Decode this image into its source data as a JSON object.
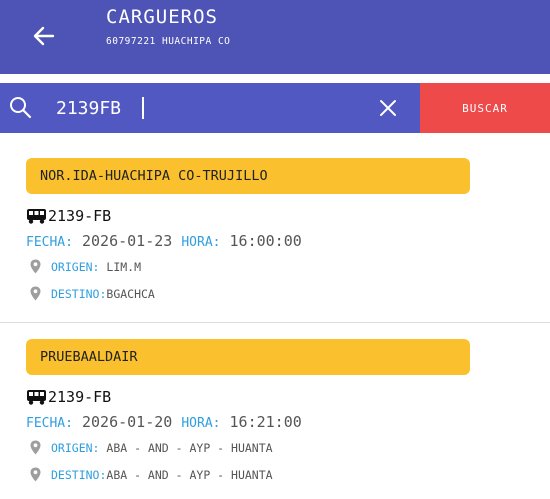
{
  "header": {
    "title": "CARGUEROS",
    "subtitle": "60797221 HUACHIPA CO"
  },
  "search": {
    "value": "2139FB",
    "button_label": "BUSCAR"
  },
  "colors": {
    "appbar": "#4e54b6",
    "searchbar": "#5158c2",
    "buscar": "#ef4a4a",
    "route_badge": "#fbc02d",
    "label_blue": "#2f9fe0"
  },
  "trips": [
    {
      "route": "NOR.IDA-HUACHIPA CO-TRUJILLO",
      "plate": "2139-FB",
      "fecha_label": "FECHA:",
      "fecha": "2026-01-23",
      "hora_label": "HORA:",
      "hora": "16:00:00",
      "origen_label": "ORIGEN:",
      "origen": "LIM.M",
      "destino_label": "DESTINO:",
      "destino": "BGACHCA"
    },
    {
      "route": "PRUEBAALDAIR",
      "plate": "2139-FB",
      "fecha_label": "FECHA:",
      "fecha": "2026-01-20",
      "hora_label": "HORA:",
      "hora": "16:21:00",
      "origen_label": "ORIGEN:",
      "origen": "ABA - AND - AYP - HUANTA",
      "destino_label": "DESTINO:",
      "destino": "ABA - AND - AYP - HUANTA"
    }
  ],
  "icons": {
    "back": "arrow-left-icon",
    "search": "search-icon",
    "clear": "close-icon",
    "vehicle": "bus-icon",
    "location": "location-pin-icon"
  }
}
